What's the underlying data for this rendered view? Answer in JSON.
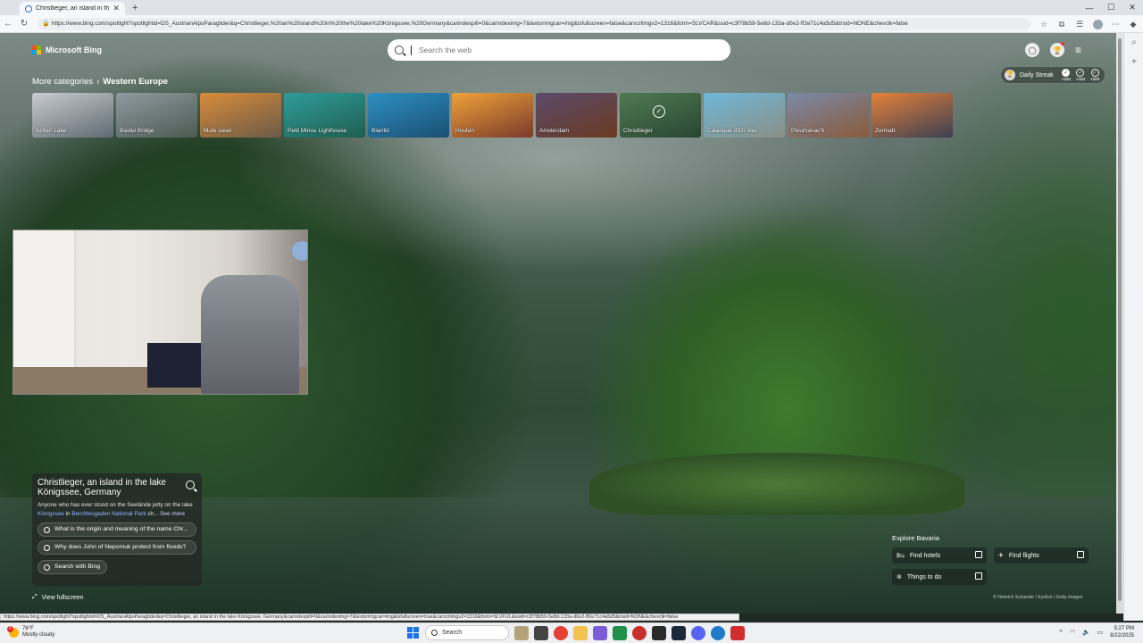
{
  "browser": {
    "tab_title": "Christlieger, an island in the lake Königssee, Germany",
    "tab_close": "✕",
    "new_tab": "+",
    "url": "https://www.bing.com/spotlight?spotlightid=DS_AustrianAlpsParaglider&q=Christlieger,%20an%20island%20in%20the%20lake%20Königssee,%20Germany&carindexpill=0&carindeximg=7&textorimgcar=img&isfullscreen=false&carscrlimgv2=1316&form=SLVCAR&ssid=c3f78b59-5e8d-133a-d0e2-ff2e71c4a5d5&trsid=NONE&chevclk=false",
    "status_url": "https://www.bing.com/spotlight?spotlightid=DS_AustrianAlpsParaglider&q=Christlieger, an island in the lake Königssee, Germany&carindexpill=0&carindeximg=7&textorimgcar=img&isfullscreen=true&carscrlimgv2=1316&form=SLVFUL&ssid=c3f78b59-5e8d-133a-d0e2-ff2e71c4a5d5&trsid=NONE&chevclk=false"
  },
  "bing": {
    "logo_text": "Microsoft Bing",
    "search_placeholder": "Search the web",
    "daily_streak": "Daily Streak",
    "streak_points": [
      "+100",
      "+150",
      "+200"
    ],
    "breadcrumb": {
      "parent": "More categories",
      "separator": "›",
      "current": "Western Europe"
    },
    "categories": [
      {
        "label": "Achen Lake",
        "c1": "#c9ccd0",
        "c2": "#5f6a72"
      },
      {
        "label": "Bastei Bridge",
        "c1": "#8f9aa0",
        "c2": "#4d5a52"
      },
      {
        "label": "Mute swan",
        "c1": "#d98c3a",
        "c2": "#6b5a48"
      },
      {
        "label": "Petit Minou Lighthouse",
        "c1": "#2f9c9a",
        "c2": "#1f5e4f"
      },
      {
        "label": "Biarritz",
        "c1": "#2d8fc2",
        "c2": "#1a4f73"
      },
      {
        "label": "Houten",
        "c1": "#f0a23a",
        "c2": "#7a3a2a"
      },
      {
        "label": "Amsterdam",
        "c1": "#5a4a6a",
        "c2": "#6b3a22"
      },
      {
        "label": "Christlieger",
        "c1": "#4f7a52",
        "c2": "#2a4532"
      },
      {
        "label": "Calanque d'En Vau",
        "c1": "#6fb8d8",
        "c2": "#8a8f86"
      },
      {
        "label": "Ploumanac'h",
        "c1": "#7a8aa8",
        "c2": "#8a5a3a"
      },
      {
        "label": "Zermatt",
        "c1": "#e6813a",
        "c2": "#3a3f52"
      }
    ],
    "info": {
      "title": "Christlieger, an island in the lake Königssee, Germany",
      "desc_prefix": "Anyone who has ever stood on the Seelände jetty on the lake",
      "link1": "Königssee",
      "desc_mid": " in ",
      "link2": "Berchtesgaden National Park",
      "desc_suffix": " sh...",
      "see_more": "See more",
      "questions": [
        "What is the origin and meaning of the name Chr...",
        "Why does John of Nepomuk protect from floods?"
      ],
      "search_with": "Search with Bing"
    },
    "view_fullscreen": "View fullscreen",
    "explore": {
      "title": "Explore Bavaria",
      "items": [
        "Find hotels",
        "Find flights",
        "Things to do"
      ]
    },
    "credit": "© Heinrich Schaeder / EyeEm / Getty Images"
  },
  "taskbar": {
    "temp": "76°F",
    "weather": "Mostly cloudy",
    "badge": "6",
    "search": "Search",
    "time": "5:27 PM",
    "date": "8/22/2025"
  },
  "colors": {
    "accent": "#1a73e8",
    "link": "#8fb4ff"
  }
}
